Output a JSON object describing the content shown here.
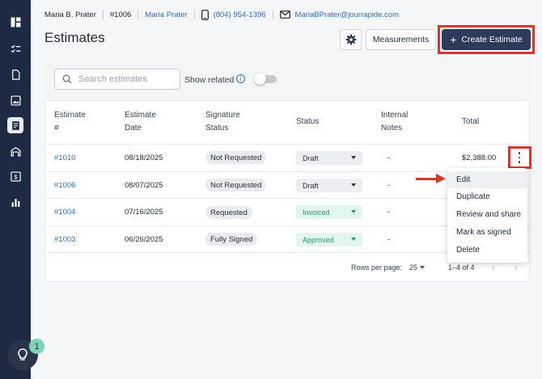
{
  "topbar": {
    "customer_name": "Maria B. Prater",
    "job_number": "#1006",
    "customer_link": "Maria Prater",
    "phone": "(804) 954-1396",
    "email": "MariaBPrater@jourrapide.com"
  },
  "page": {
    "title": "Estimates",
    "measurements_label": "Measurements",
    "create_label": "Create Estimate",
    "create_prefix": "+"
  },
  "filters": {
    "search_placeholder": "Search estimates",
    "show_related_label": "Show related",
    "show_related_on": false
  },
  "table": {
    "headers": {
      "estimate_no": [
        "Estimate",
        "#"
      ],
      "estimate_date": [
        "Estimate",
        "Date"
      ],
      "signature_status": [
        "Signature",
        "Status"
      ],
      "status": "Status",
      "internal_notes": [
        "Internal",
        "Notes"
      ],
      "total": "Total"
    },
    "rows": [
      {
        "number": "#1010",
        "date": "08/18/2025",
        "signature": "Not Requested",
        "status": "Draft",
        "notes": "-",
        "total": "$2,388.00"
      },
      {
        "number": "#1006",
        "date": "08/07/2025",
        "signature": "Not Requested",
        "status": "Draft",
        "notes": "-",
        "total": ""
      },
      {
        "number": "#1004",
        "date": "07/16/2025",
        "signature": "Requested",
        "status": "Invoiced",
        "notes": "-",
        "total": ""
      },
      {
        "number": "#1003",
        "date": "06/26/2025",
        "signature": "Fully Signed",
        "status": "Approved",
        "notes": "-",
        "total": ""
      }
    ]
  },
  "pagination": {
    "rows_per_page_label": "Rows per page:",
    "rows_per_page": "25",
    "range": "1–4 of 4"
  },
  "row_menu": {
    "items": [
      "Edit",
      "Duplicate",
      "Review and share",
      "Mark as signed",
      "Delete"
    ]
  },
  "help": {
    "badge": "1"
  },
  "colors": {
    "sidebar": "#1e2a44",
    "primary": "#2d3a5a",
    "link": "#2f6fb5",
    "highlight": "#e0332a",
    "status_green": "#1f9d6a"
  },
  "icons": [
    "dashboard-icon",
    "checklist-icon",
    "document-icon",
    "image-icon",
    "estimates-icon",
    "warehouse-icon",
    "dollar-icon",
    "bar-chart-icon",
    "phone-icon",
    "mail-icon",
    "gear-icon",
    "search-icon",
    "info-icon",
    "kebab-icon",
    "lightbulb-icon"
  ]
}
